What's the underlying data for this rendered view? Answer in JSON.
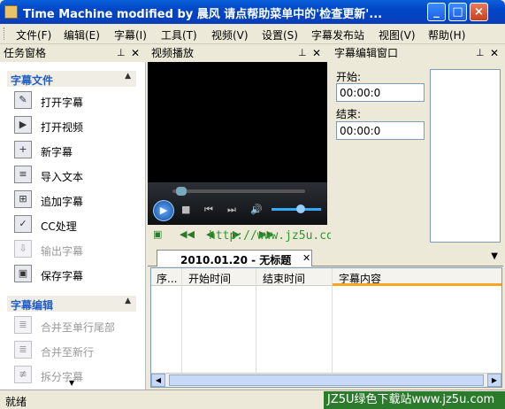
{
  "window": {
    "title": "Time Machine modified by 晨风 请点帮助菜单中的'检查更新'..."
  },
  "menu": [
    "文件(F)",
    "编辑(E)",
    "字幕(I)",
    "工具(T)",
    "视频(V)",
    "设置(S)",
    "字幕发布站",
    "视图(V)",
    "帮助(H)"
  ],
  "panels": {
    "task": "任务窗格",
    "video": "视频播放",
    "edit": "字幕编辑窗口"
  },
  "task_groups": [
    {
      "title": "字幕文件",
      "items": [
        {
          "label": "打开字幕",
          "icon": "open-subtitle-icon",
          "disabled": false
        },
        {
          "label": "打开视频",
          "icon": "open-video-icon",
          "disabled": false
        },
        {
          "label": "新字幕",
          "icon": "new-subtitle-icon",
          "disabled": false
        },
        {
          "label": "导入文本",
          "icon": "import-text-icon",
          "disabled": false
        },
        {
          "label": "追加字幕",
          "icon": "append-subtitle-icon",
          "disabled": false
        },
        {
          "label": "CC处理",
          "icon": "cc-process-icon",
          "disabled": false
        },
        {
          "label": "输出字幕",
          "icon": "export-subtitle-icon",
          "disabled": true
        },
        {
          "label": "保存字幕",
          "icon": "save-subtitle-icon",
          "disabled": false
        }
      ]
    },
    {
      "title": "字幕编辑",
      "items": [
        {
          "label": "合并至单行尾部",
          "icon": "merge-line-end-icon",
          "disabled": true
        },
        {
          "label": "合并至新行",
          "icon": "merge-new-line-icon",
          "disabled": true
        },
        {
          "label": "拆分字幕",
          "icon": "split-subtitle-icon",
          "disabled": true
        }
      ]
    }
  ],
  "edit": {
    "start_label": "开始:",
    "start_value": "00:00:0",
    "end_label": "结束:",
    "end_value": "00:00:0"
  },
  "document": {
    "tab_title": "2010.01.20 - 无标题"
  },
  "table": {
    "columns": [
      "序...",
      "开始时间",
      "结束时间",
      "字幕内容"
    ]
  },
  "status": {
    "text": "就绪"
  },
  "watermark": "JZ5U绿色下载站www.jz5u.com",
  "url_overlay": "http://www.jz5u.com",
  "colors": {
    "titlebar": "#0a5fd8",
    "accent": "#215dc6",
    "sort": "#f5a623"
  }
}
